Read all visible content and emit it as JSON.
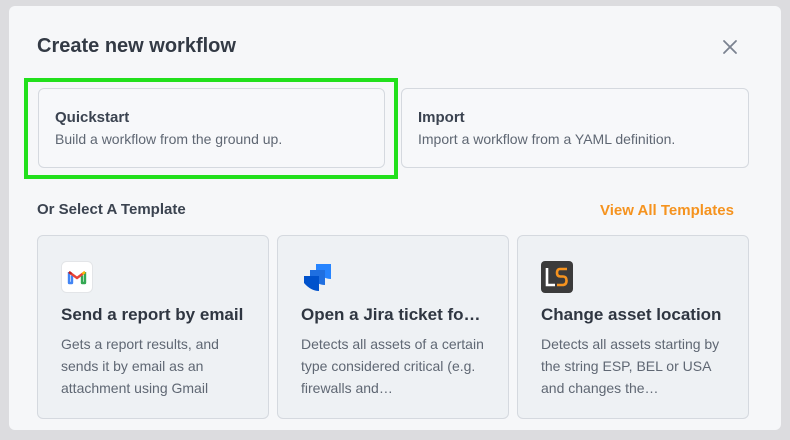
{
  "dialog": {
    "title": "Create new workflow"
  },
  "options": [
    {
      "title": "Quickstart",
      "description": "Build a workflow from the ground up."
    },
    {
      "title": "Import",
      "description": "Import a workflow from a YAML definition."
    }
  ],
  "templates_section": {
    "heading": "Or Select A Template",
    "view_all_label": "View All Templates"
  },
  "templates": [
    {
      "icon": "gmail-icon",
      "title": "Send a report by email",
      "description": "Gets a report results, and sends it by email as an attachment using Gmail"
    },
    {
      "icon": "jira-icon",
      "title": "Open a Jira ticket for…",
      "description": "Detects all assets of a certain type considered critical (e.g. firewalls and…"
    },
    {
      "icon": "ls-logo-icon",
      "title": "Change asset location",
      "description": "Detects all assets starting by the string ESP, BEL or USA and changes the…"
    }
  ],
  "colors": {
    "accent": "#f5931f",
    "highlight": "#22e01c"
  }
}
